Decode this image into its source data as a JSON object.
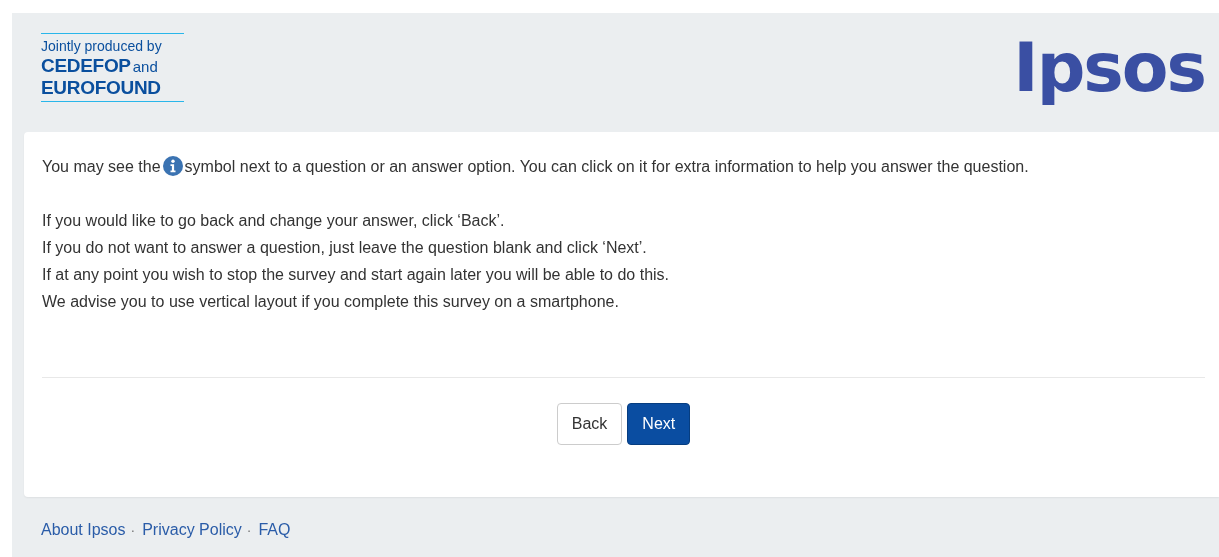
{
  "header": {
    "partner_logo": {
      "tagline": "Jointly produced by",
      "name_1": "CEDEFOP",
      "conjunction": "and",
      "name_2": "EUROFOUND"
    },
    "brand_logo": "Ipsos"
  },
  "intro": {
    "before_icon": "You may see the",
    "after_icon": "symbol next to a question or an answer option. You can click on it for extra information to help you answer the question."
  },
  "instructions": [
    "If you would like to go back and change your answer, click ‘Back’.",
    "If you do not want to answer a question, just leave the question blank and click ‘Next’.",
    "If at any point you wish to stop the survey and start again later you will be able to do this.",
    "We advise you to use vertical layout if you complete this survey on a smartphone."
  ],
  "buttons": [
    {
      "label": "Back",
      "kind": "secondary"
    },
    {
      "label": "Next",
      "kind": "primary"
    }
  ],
  "footer_links": [
    {
      "label": "About Ipsos",
      "separator": "·"
    },
    {
      "label": "Privacy Policy",
      "separator": "·"
    },
    {
      "label": "FAQ"
    }
  ]
}
